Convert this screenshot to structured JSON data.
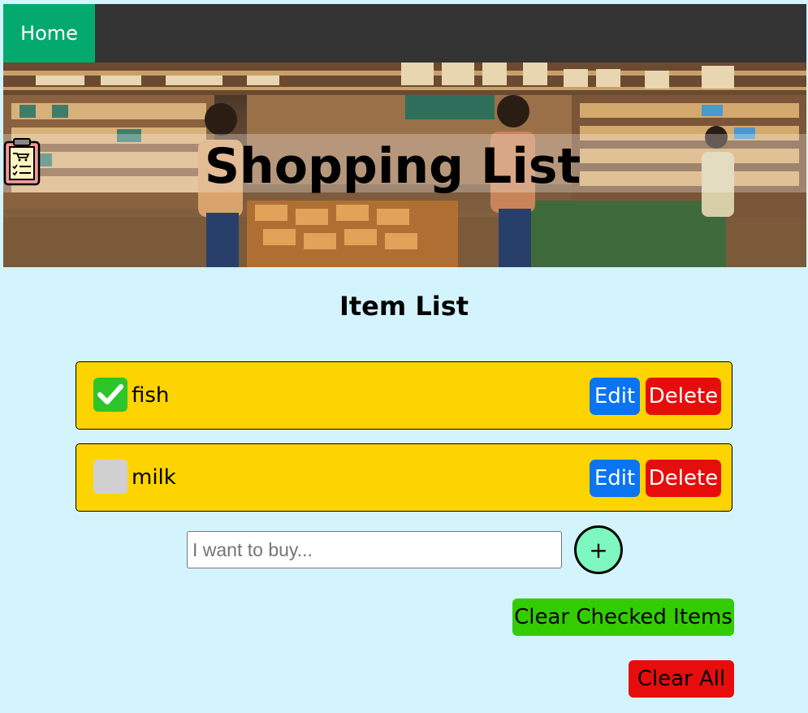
{
  "nav": {
    "home_label": "Home"
  },
  "hero": {
    "title": "Shopping List",
    "icon": "clipboard-checklist-icon"
  },
  "list": {
    "heading": "Item List",
    "items": [
      {
        "label": "fish",
        "checked": true,
        "edit_label": "Edit",
        "delete_label": "Delete"
      },
      {
        "label": "milk",
        "checked": false,
        "edit_label": "Edit",
        "delete_label": "Delete"
      }
    ]
  },
  "add": {
    "placeholder": "I want to buy...",
    "value": "",
    "button_label": "+"
  },
  "actions": {
    "clear_checked_label": "Clear Checked Items",
    "clear_all_label": "Clear All"
  },
  "colors": {
    "nav_bg": "#333333",
    "home_bg": "#04aa6d",
    "page_bg": "#d3f3fd",
    "item_bg": "#fdd400",
    "edit_bg": "#0a74f2",
    "delete_bg": "#e80d0d",
    "checked_bg": "#2ec52a",
    "add_bg": "#7ef7c0",
    "clear_checked_bg": "#33cc00",
    "clear_all_bg": "#e80d0d"
  }
}
